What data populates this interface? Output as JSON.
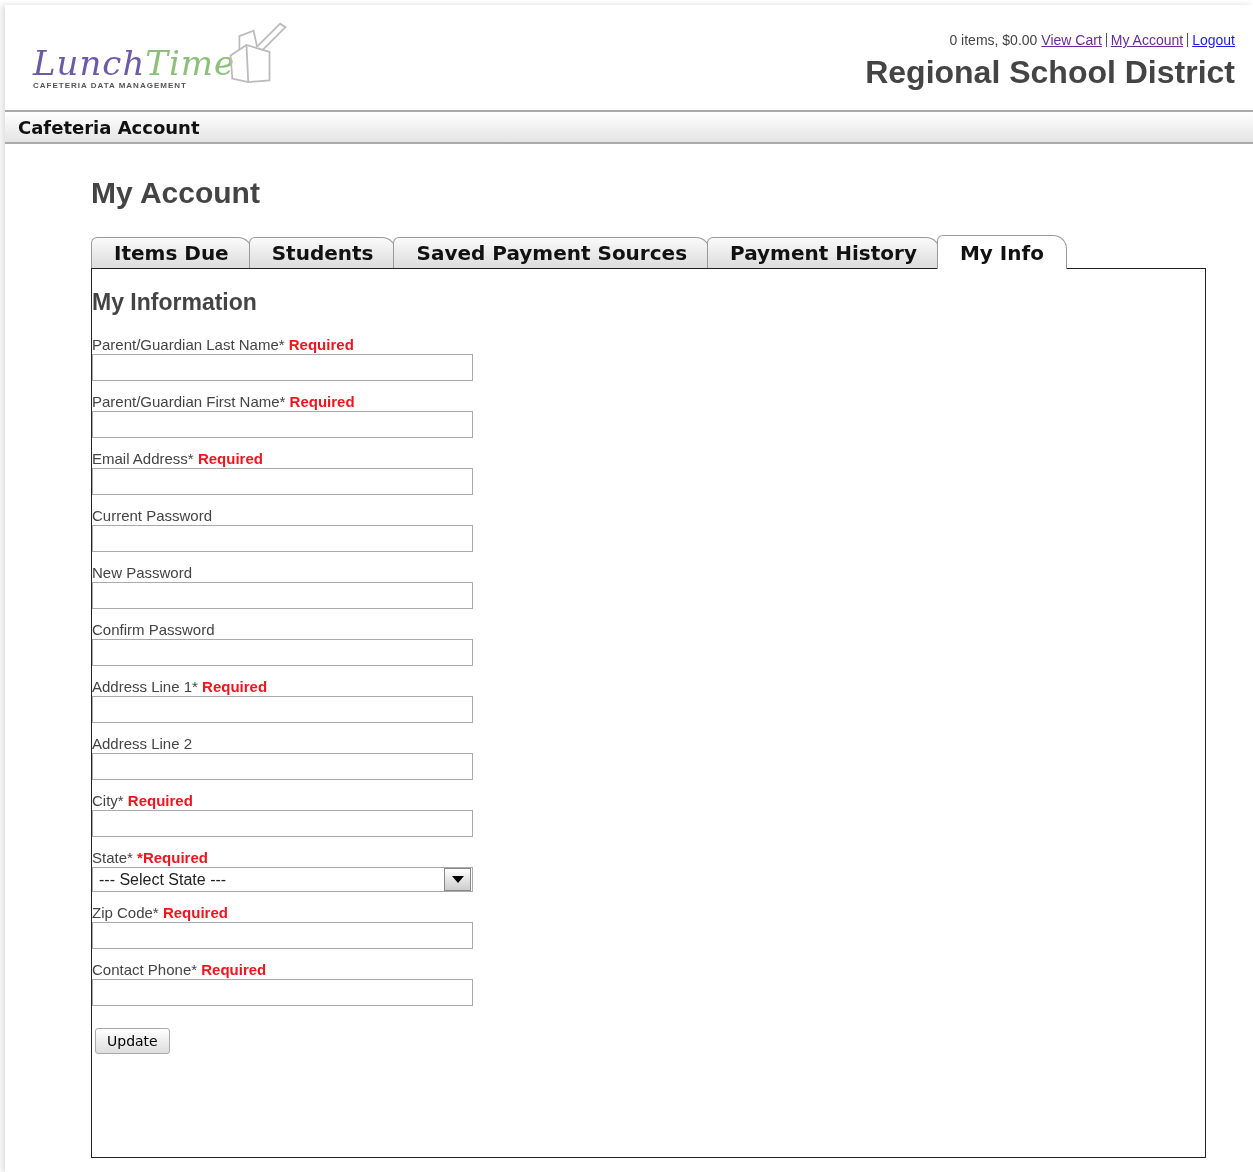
{
  "logo": {
    "word_1": "Lunch",
    "word_2": "Time",
    "tagline": "CAFETERIA DATA MANAGEMENT"
  },
  "cart_summary": "0 items, $0.00",
  "header_links": [
    {
      "label": "View Cart",
      "visited": true
    },
    {
      "label": "My Account",
      "visited": true
    },
    {
      "label": "Logout",
      "visited": false
    }
  ],
  "district": "Regional School District",
  "section_bar": "Cafeteria Account",
  "page_title": "My Account",
  "tabs": [
    {
      "label": "Items Due",
      "selected": false
    },
    {
      "label": "Students",
      "selected": false
    },
    {
      "label": "Saved Payment Sources",
      "selected": false
    },
    {
      "label": "Payment History",
      "selected": false
    },
    {
      "label": "My Info",
      "selected": true
    }
  ],
  "form": {
    "title": "My Information",
    "fields": [
      {
        "kind": "text",
        "label": "Parent/Guardian Last Name*",
        "note": "Required"
      },
      {
        "kind": "text",
        "label": "Parent/Guardian First Name*",
        "note": "Required"
      },
      {
        "kind": "text",
        "label": "Email Address*",
        "note": "Required"
      },
      {
        "kind": "text",
        "label": "Current Password"
      },
      {
        "kind": "text",
        "label": "New Password"
      },
      {
        "kind": "text",
        "label": "Confirm Password"
      },
      {
        "kind": "text",
        "label": "Address Line 1*",
        "note": "Required"
      },
      {
        "kind": "text",
        "label": "Address Line 2"
      },
      {
        "kind": "text",
        "label": "City*",
        "note": "Required"
      },
      {
        "kind": "select",
        "label": "State*",
        "note": "*Required",
        "value": "--- Select State ---"
      },
      {
        "kind": "text",
        "label": "Zip Code*",
        "note": "Required"
      },
      {
        "kind": "text",
        "label": "Contact Phone*",
        "note": "Required"
      }
    ],
    "button": "Update"
  }
}
